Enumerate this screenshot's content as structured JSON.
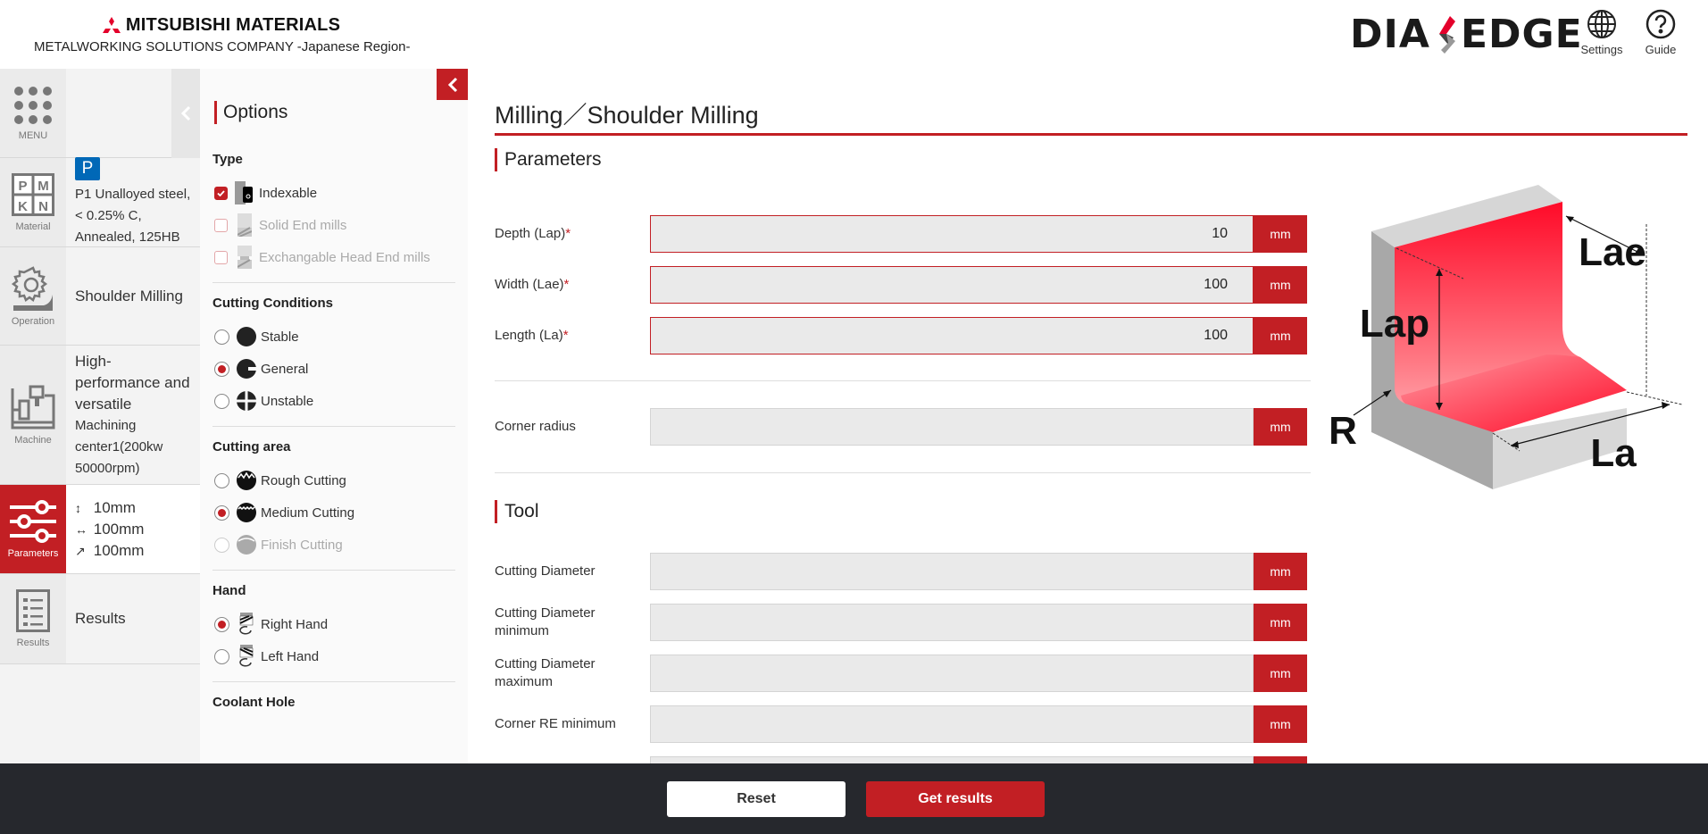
{
  "header": {
    "brand_name": "MITSUBISHI MATERIALS",
    "brand_subtitle": "METALWORKING SOLUTIONS COMPANY -Japanese Region-",
    "product_logo_left": "DIA",
    "product_logo_right": "EDGE",
    "settings_label": "Settings",
    "guide_label": "Guide"
  },
  "nav": {
    "menu_label": "MENU",
    "material": {
      "icon_label": "Material",
      "badge": "P",
      "grid": [
        "P",
        "M",
        "K",
        "N"
      ],
      "text": "P1 Unalloyed steel, < 0.25% C, Annealed, 125HB"
    },
    "operation": {
      "icon_label": "Operation",
      "text": "Shoulder Milling"
    },
    "machine": {
      "icon_label": "Machine",
      "title": "High-performance and versatile",
      "detail": "Machining center1(200kw 50000rpm)"
    },
    "parameters": {
      "icon_label": "Parameters",
      "lines": [
        {
          "symbol": "↕",
          "value": "10mm"
        },
        {
          "symbol": "↔",
          "value": "100mm"
        },
        {
          "symbol": "↗",
          "value": "100mm"
        }
      ]
    },
    "results": {
      "icon_label": "Results",
      "text": "Results"
    }
  },
  "options": {
    "title": "Options",
    "type": {
      "heading": "Type",
      "items": [
        {
          "label": "Indexable",
          "checked": true,
          "enabled": true
        },
        {
          "label": "Solid End mills",
          "checked": false,
          "enabled": false
        },
        {
          "label": "Exchangable Head End mills",
          "checked": false,
          "enabled": false
        }
      ]
    },
    "cutting_conditions": {
      "heading": "Cutting Conditions",
      "items": [
        {
          "label": "Stable",
          "selected": false
        },
        {
          "label": "General",
          "selected": true
        },
        {
          "label": "Unstable",
          "selected": false
        }
      ]
    },
    "cutting_area": {
      "heading": "Cutting area",
      "items": [
        {
          "label": "Rough Cutting",
          "selected": false,
          "enabled": true
        },
        {
          "label": "Medium Cutting",
          "selected": true,
          "enabled": true
        },
        {
          "label": "Finish Cutting",
          "selected": false,
          "enabled": false
        }
      ]
    },
    "hand": {
      "heading": "Hand",
      "items": [
        {
          "label": "Right Hand",
          "selected": true
        },
        {
          "label": "Left Hand",
          "selected": false
        }
      ]
    },
    "coolant_heading": "Coolant Hole"
  },
  "main": {
    "page_title": "Milling／Shoulder Milling",
    "parameters_title": "Parameters",
    "fields": [
      {
        "label": "Depth (Lap)",
        "required": "*",
        "value": "10",
        "unit": "mm"
      },
      {
        "label": "Width (Lae)",
        "required": "*",
        "value": "100",
        "unit": "mm"
      },
      {
        "label": "Length (La)",
        "required": "*",
        "value": "100",
        "unit": "mm"
      }
    ],
    "corner_radius": {
      "label": "Corner radius",
      "value": "",
      "unit": "mm"
    },
    "tool_title": "Tool",
    "tool_fields": [
      {
        "label": "Cutting Diameter",
        "value": "",
        "unit": "mm"
      },
      {
        "label": "Cutting Diameter minimum",
        "value": "",
        "unit": "mm"
      },
      {
        "label": "Cutting Diameter maximum",
        "value": "",
        "unit": "mm"
      },
      {
        "label": "Corner RE minimum",
        "value": "",
        "unit": "mm"
      },
      {
        "label": "",
        "value": "",
        "unit": ""
      }
    ],
    "diagram_labels": {
      "lae": "Lae",
      "lap": "Lap",
      "la": "La",
      "r": "R"
    }
  },
  "footer": {
    "reset_label": "Reset",
    "results_label": "Get results"
  },
  "colors": {
    "accent": "#c21f24",
    "material_p": "#0068b7",
    "footer_bg": "#26282d"
  }
}
